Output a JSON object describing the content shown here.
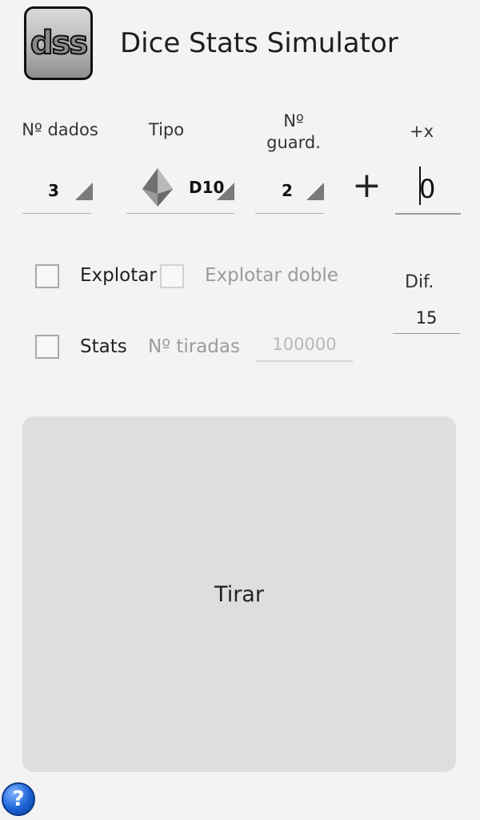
{
  "header": {
    "logo_text": "dss",
    "title": "Dice Stats Simulator"
  },
  "columns": {
    "dados_label": "Nº dados",
    "tipo_label": "Tipo",
    "guard_label_line1": "Nº",
    "guard_label_line2": "guard.",
    "plusx_label": "+x"
  },
  "spinners": {
    "dados_value": "3",
    "tipo_value": "D10",
    "tipo_icon": "d10-die-icon",
    "guard_value": "2"
  },
  "plus_sign": "+",
  "x_value": "0",
  "options": {
    "explotar_label": "Explotar",
    "explotar_checked": false,
    "explotar_doble_label": "Explotar doble",
    "explotar_doble_checked": false,
    "stats_label": "Stats",
    "stats_checked": false,
    "tiradas_label": "Nº tiradas",
    "tiradas_value": "100000"
  },
  "dif": {
    "label": "Dif.",
    "value": "15"
  },
  "roll_button_label": "Tirar",
  "help_icon": "help-icon",
  "help_glyph": "?"
}
